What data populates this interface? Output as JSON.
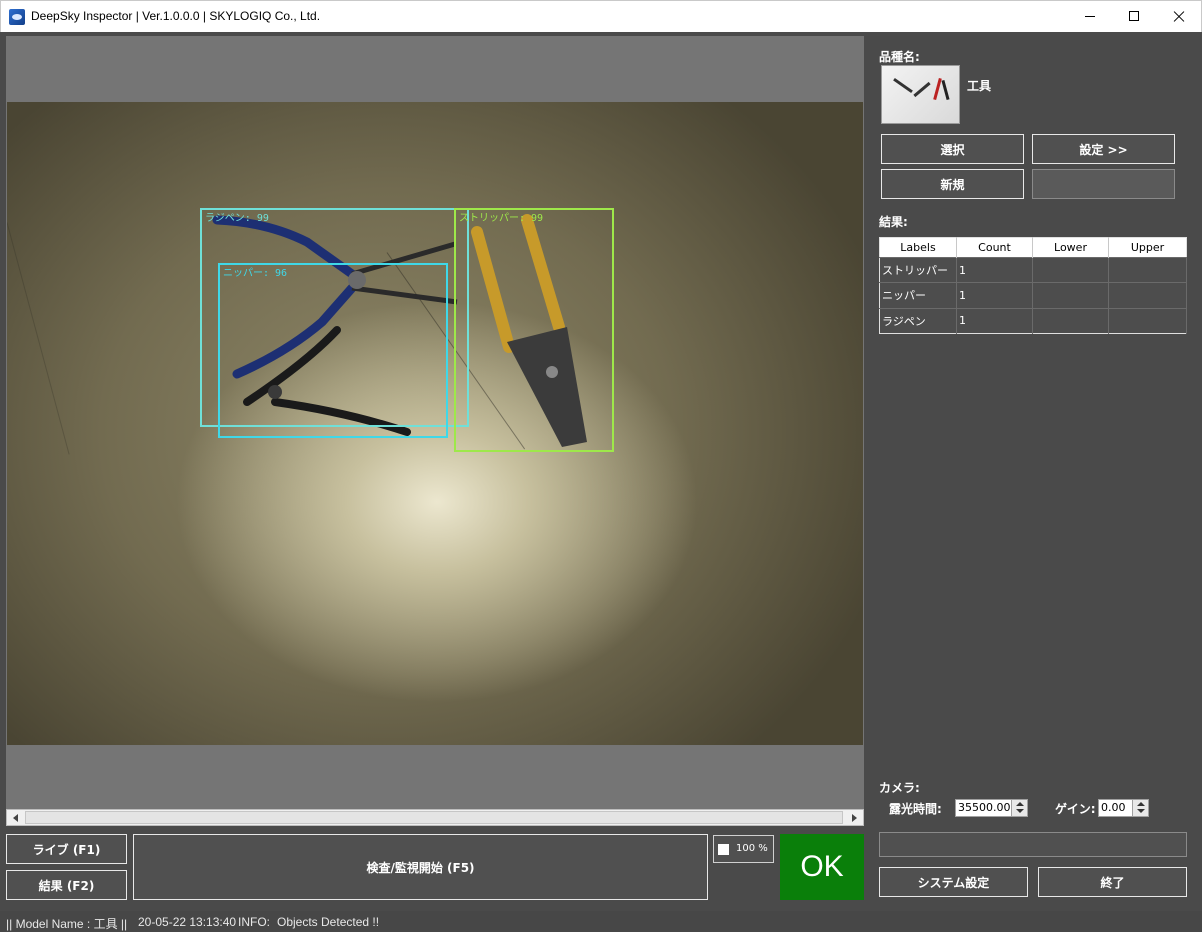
{
  "window": {
    "title": "DeepSky Inspector | Ver.1.0.0.0 | SKYLOGIQ Co., Ltd."
  },
  "detections": [
    {
      "label": "ラジペン: 99",
      "color": "#6fe0d8"
    },
    {
      "label": "ニッパー: 96",
      "color": "#3fd8e8"
    },
    {
      "label": "ストリッパー: 99",
      "color": "#9ee84a"
    }
  ],
  "controls": {
    "live_button": "ライブ (F1)",
    "result_button": "結果 (F2)",
    "inspect_button": "検査/監視開始 (F5)",
    "zoom": "100 %",
    "verdict": "OK",
    "verdict_color": "#0a7f0a"
  },
  "side": {
    "product_label": "品種名:",
    "product_name": "工具",
    "select_button": "選択",
    "settings_button": "設定 >>",
    "new_button": "新規",
    "results_label": "結果:",
    "results_table": {
      "headers": [
        "Labels",
        "Count",
        "Lower",
        "Upper"
      ],
      "rows": [
        {
          "label": "ストリッパー",
          "count": "1",
          "lower": "",
          "upper": ""
        },
        {
          "label": "ニッパー",
          "count": "1",
          "lower": "",
          "upper": ""
        },
        {
          "label": "ラジペン",
          "count": "1",
          "lower": "",
          "upper": ""
        }
      ]
    },
    "camera_label": "カメラ:",
    "exposure_label": "露光時間:",
    "exposure_value": "35500.00",
    "gain_label": "ゲイン:",
    "gain_value": "0.00",
    "system_settings_button": "システム設定",
    "exit_button": "終了"
  },
  "statusbar": {
    "model": "|| Model Name : 工具 ||",
    "datetime": "20-05-22 13:13:40",
    "info_label": "INFO:",
    "info_text": "Objects Detected !!"
  }
}
